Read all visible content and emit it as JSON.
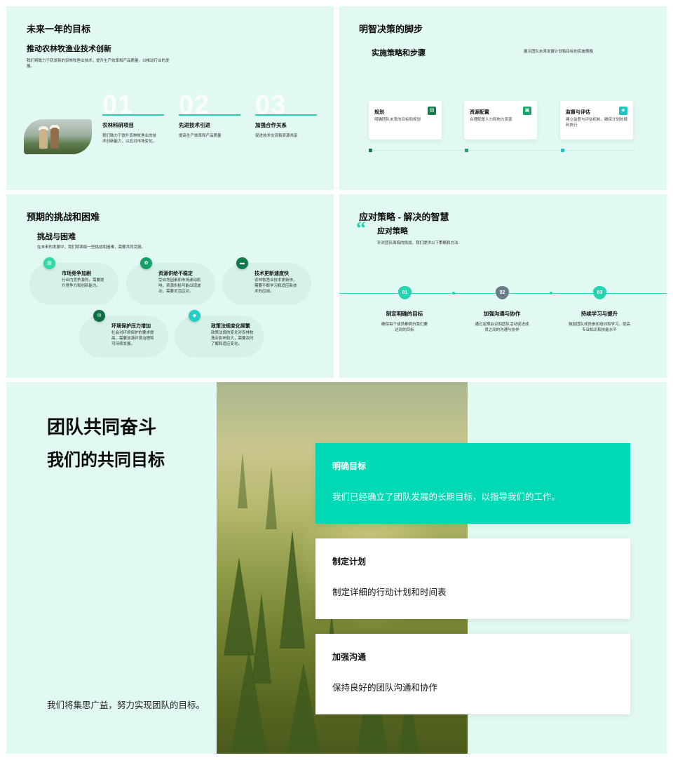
{
  "slide1": {
    "title": "未来一年的目标",
    "subtitle": "推动农林牧渔业技术创新",
    "desc": "我们将致力于研发新的农林牧渔业技术，提升生产效率和产品质量，以推动行业的发展。",
    "items": [
      {
        "num": "01",
        "title": "农林科研项目",
        "desc": "我们致力于提升农林牧渔业的技术创新能力，以应对市场变化。"
      },
      {
        "num": "02",
        "title": "先进技术引进",
        "desc": "提高生产效率和产品质量"
      },
      {
        "num": "03",
        "title": "加强合作关系",
        "desc": "促进技术交流和资源共享"
      }
    ]
  },
  "slide2": {
    "title": "明智决策的脚步",
    "subtitle": "实施策略和步骤",
    "note": "展示团队未来发展计划和目标的实施策略",
    "cards": [
      {
        "title": "规划",
        "desc": "明确团队未来的目标和规划",
        "icon": "chart-icon",
        "color": "#167a4e"
      },
      {
        "title": "资源配置",
        "desc": "合理配置人力和物力资源",
        "icon": "box-icon",
        "color": "#18a36a"
      },
      {
        "title": "监督与评估",
        "desc": "建立监督与评估机制，确保计划的顺利执行",
        "icon": "tag-icon",
        "color": "#1fc4c0"
      }
    ],
    "dot_colors": [
      "#167a4e",
      "#18a36a",
      "#1fc4c0"
    ]
  },
  "slide3": {
    "title": "预期的挑战和困难",
    "subtitle": "挑战与困难",
    "desc": "在未来的发展中，我们将面临一些挑战和困难，需要共同克服。",
    "items": [
      {
        "title": "市场竞争加剧",
        "desc": "行业内竞争激烈，需要提升竞争力和创新能力。",
        "icon": "building-icon",
        "color": "#2fd9a8"
      },
      {
        "title": "资源供给不稳定",
        "desc": "受自然因素和市场波动影响，资源供给可能出现波动，需要灵活应对。",
        "icon": "gear-icon",
        "color": "#16a16b"
      },
      {
        "title": "技术更新速度快",
        "desc": "农林牧渔业技术更新快，需要不断学习和适应新技术的应用。",
        "icon": "truck-icon",
        "color": "#117a4c"
      },
      {
        "title": "环境保护压力增加",
        "desc": "社会对环境保护的要求提高，需要加强环境治理和可持续发展。",
        "icon": "mail-icon",
        "color": "#0f6e45"
      },
      {
        "title": "政策法规变化频繁",
        "desc": "政策法规的变化对农林牧渔业影响较大，需要及时了解和适应变化。",
        "icon": "shield-icon",
        "color": "#25cfc6"
      }
    ]
  },
  "slide4": {
    "title": "应对策略 - 解决的智慧",
    "subtitle": "应对策略",
    "desc": "针对团队面临的挑战，我们提供以下策略和方法",
    "items": [
      {
        "num": "01",
        "title": "制定明确的目标",
        "desc": "确保每个成员都明白我们要达到的目标",
        "color": "#26d3b1"
      },
      {
        "num": "02",
        "title": "加强沟通与协作",
        "desc": "通过定期会议和团队活动促进成员之间的沟通与协作",
        "color": "#6a7c88"
      },
      {
        "num": "03",
        "title": "持续学习与提升",
        "desc": "鼓励团队成员参加培训和学习，提高专业知识和技能水平",
        "color": "#26d3b1"
      }
    ]
  },
  "slide5": {
    "title": "团队共同奋斗",
    "subtitle": "我们的共同目标",
    "footer": "我们将集思广益，努力实现团队的目标。",
    "cards": [
      {
        "title": "明确目标",
        "desc": "我们已经确立了团队发展的长期目标，以指导我们的工作。"
      },
      {
        "title": "制定计划",
        "desc": "制定详细的行动计划和时间表"
      },
      {
        "title": "加强沟通",
        "desc": "保持良好的团队沟通和协作"
      }
    ]
  }
}
